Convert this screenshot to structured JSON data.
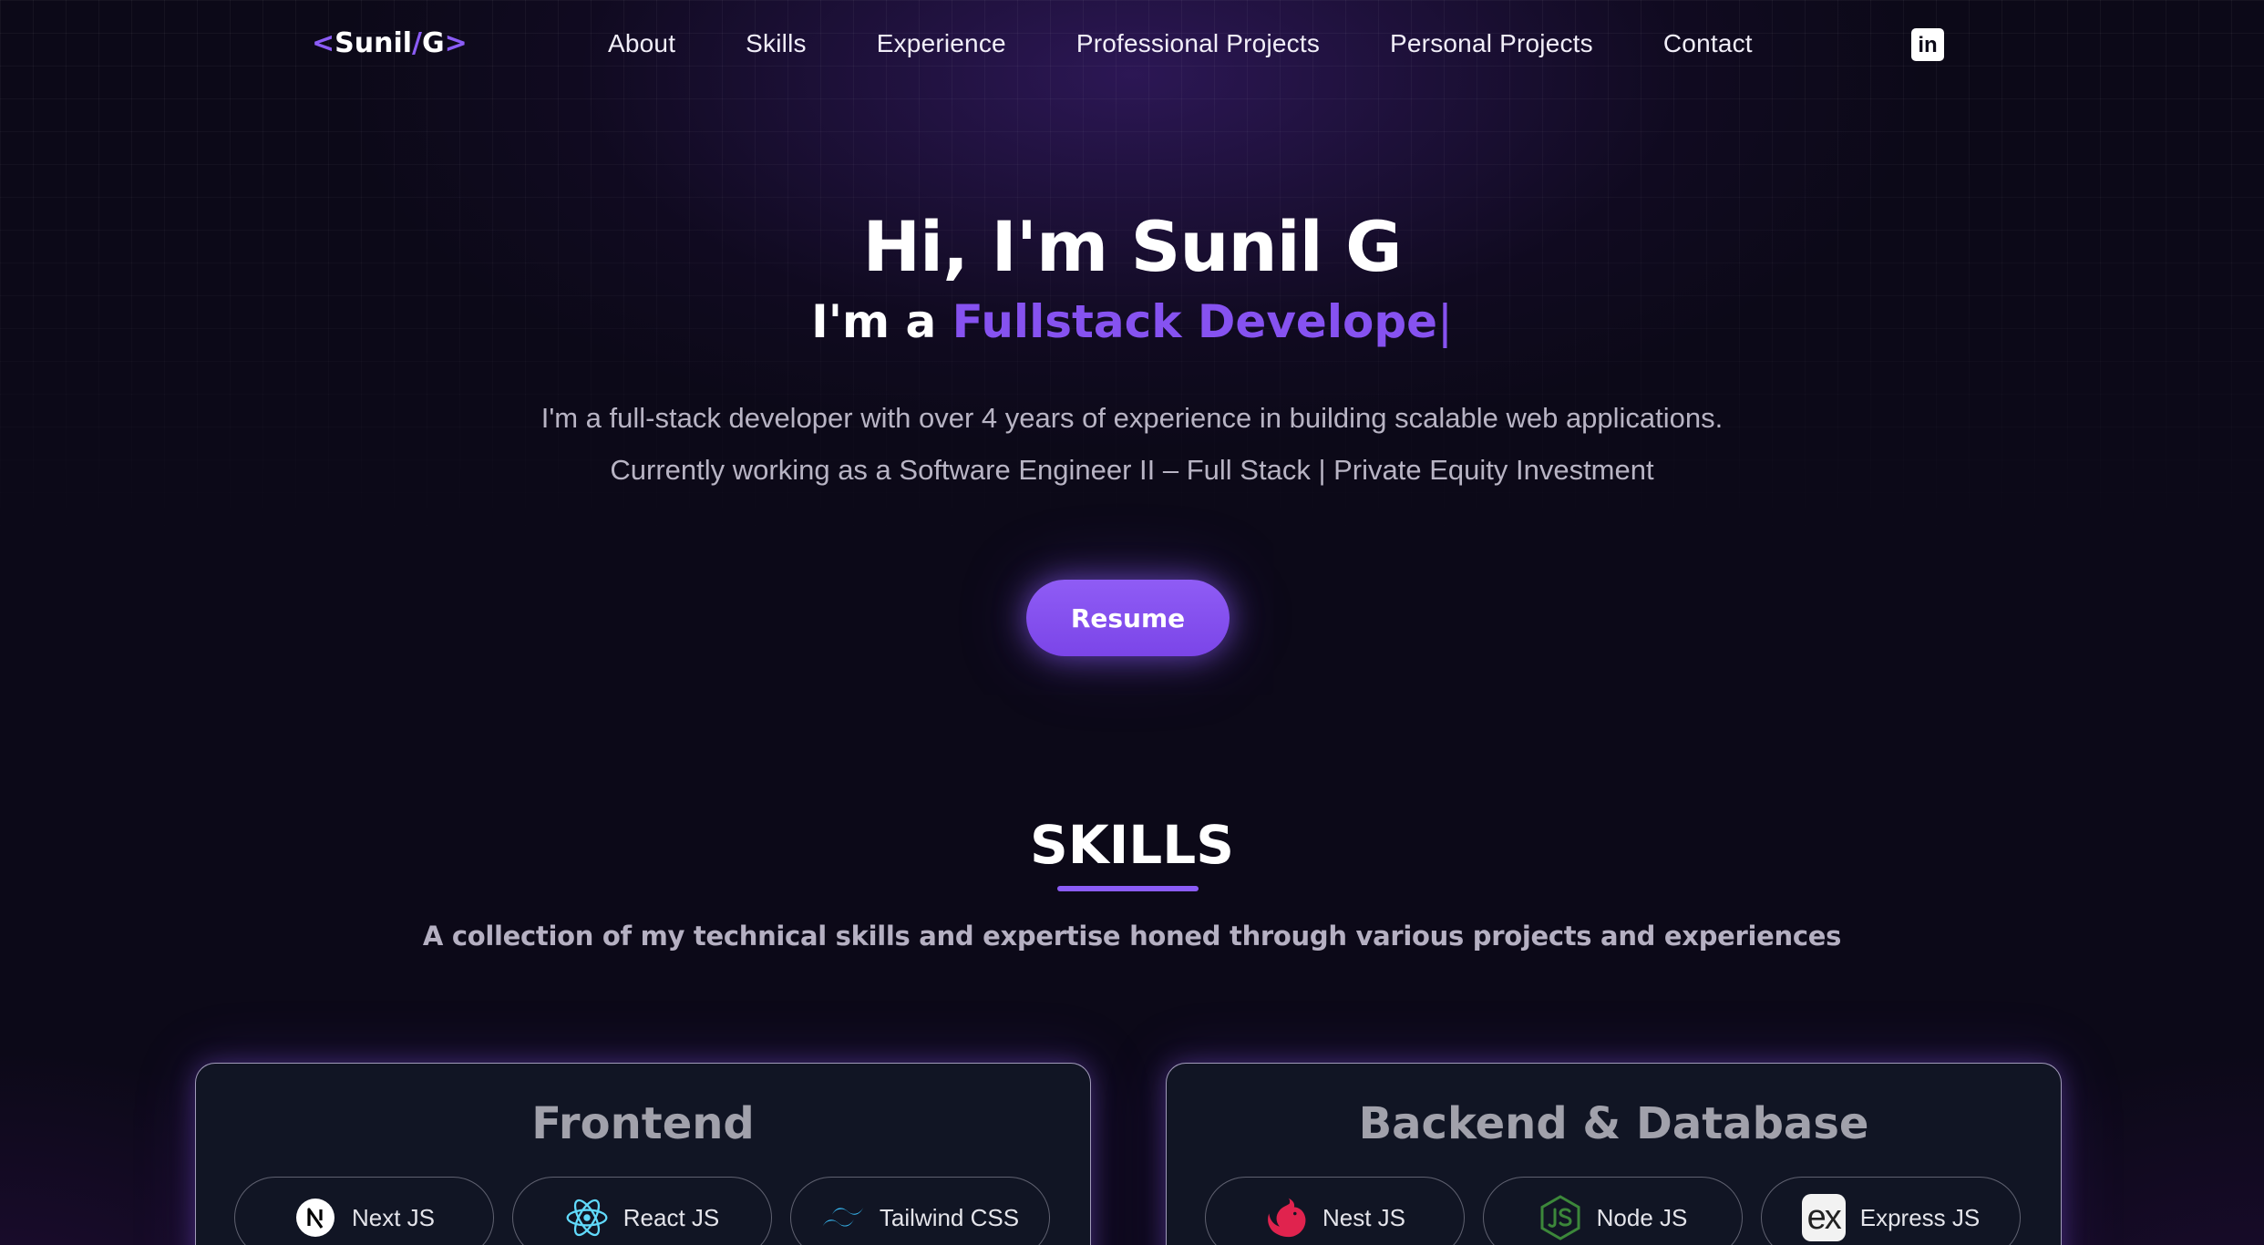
{
  "nav": {
    "logo": {
      "open": "<",
      "first": "Sunil",
      "slash": "/",
      "last": "G",
      "close": ">"
    },
    "links": [
      "About",
      "Skills",
      "Experience",
      "Professional Projects",
      "Personal Projects",
      "Contact"
    ],
    "linkedin_icon": "linkedin-icon",
    "linkedin_glyph": "in"
  },
  "hero": {
    "title": "Hi, I'm Sunil G",
    "subtitle_prefix": "I'm a ",
    "subtitle_role": "Fullstack Develope",
    "subtitle_cursor": "|",
    "desc_line1": "I'm a full-stack developer with over 4 years of experience in building scalable web applications.",
    "desc_line2": "Currently working as a Software Engineer II – Full Stack | Private Equity Investment",
    "resume_label": "Resume"
  },
  "skills": {
    "title": "SKILLS",
    "description": "A collection of my technical skills and expertise honed through various projects and experiences",
    "cards": [
      {
        "title": "Frontend",
        "chips": [
          {
            "label": "Next JS",
            "icon": "nextjs-icon"
          },
          {
            "label": "React JS",
            "icon": "react-icon"
          },
          {
            "label": "Tailwind CSS",
            "icon": "tailwind-icon"
          }
        ]
      },
      {
        "title": "Backend & Database",
        "chips": [
          {
            "label": "Nest JS",
            "icon": "nestjs-icon"
          },
          {
            "label": "Node JS",
            "icon": "nodejs-icon"
          },
          {
            "label": "Express JS",
            "icon": "express-icon",
            "icon_text": "ex"
          }
        ]
      }
    ]
  },
  "colors": {
    "accent": "#8b5cf6",
    "background": "#0c0918",
    "card_background": "#111524"
  }
}
